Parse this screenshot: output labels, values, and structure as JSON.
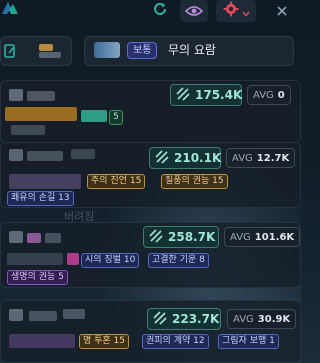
{
  "toolbar": {
    "refresh_icon": "refresh-icon",
    "eye_icon": "eye-icon",
    "gear_icon": "gear-icon",
    "close_icon": "close-icon",
    "accent": "#2bb3a6",
    "gear_color": "#e0485c"
  },
  "mutation": {
    "badge": "보통",
    "name": "무의 요람"
  },
  "cards": [
    {
      "damage": "175.4K",
      "avg_label": "AVG",
      "avg_value": "0",
      "tags": [
        "5"
      ]
    },
    {
      "damage": "210.1K",
      "avg_label": "AVG",
      "avg_value": "12.7K",
      "tags": [
        "주의 진언 15",
        "질풍의 권능 15",
        "쾌유의 손길 13"
      ],
      "ghost": "버려짐"
    },
    {
      "damage": "258.7K",
      "avg_label": "AVG",
      "avg_value": "101.6K",
      "tags": [
        "시의 징벌 10",
        "고결한 기운 8",
        "생명의 권능 5"
      ]
    },
    {
      "damage": "223.7K",
      "avg_label": "AVG",
      "avg_value": "30.9K",
      "tags": [
        "명 투혼 15",
        "권피의 계약 12",
        "그림자 보행 1"
      ]
    }
  ]
}
